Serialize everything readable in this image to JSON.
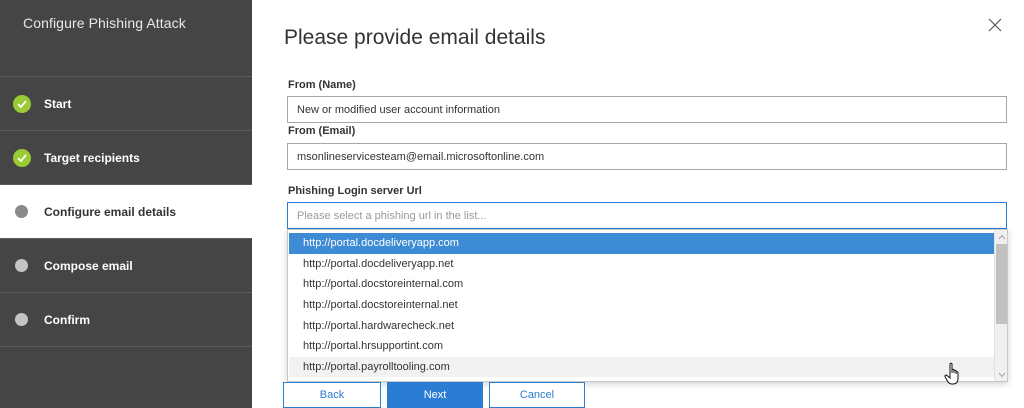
{
  "sidebar": {
    "title": "Configure Phishing Attack",
    "steps": [
      {
        "label": "Start",
        "status": "done"
      },
      {
        "label": "Target recipients",
        "status": "done"
      },
      {
        "label": "Configure email details",
        "status": "current"
      },
      {
        "label": "Compose email",
        "status": "pending"
      },
      {
        "label": "Confirm",
        "status": "pending"
      }
    ]
  },
  "main": {
    "title": "Please provide email details",
    "from_name": {
      "label": "From (Name)",
      "value": "New or modified user account information"
    },
    "from_email": {
      "label": "From (Email)",
      "value": "msonlineservicesteam@email.microsoftonline.com"
    },
    "phishing_url": {
      "label": "Phishing Login server Url",
      "placeholder": "Please select a phishing url in the list..."
    },
    "dropdown_options": [
      "http://portal.docdeliveryapp.com",
      "http://portal.docdeliveryapp.net",
      "http://portal.docstoreinternal.com",
      "http://portal.docstoreinternal.net",
      "http://portal.hardwarecheck.net",
      "http://portal.hrsupportint.com",
      "http://portal.payrolltooling.com"
    ],
    "selected_option_index": 0,
    "hovered_option_index": 6
  },
  "buttons": {
    "back": "Back",
    "next": "Next",
    "cancel": "Cancel"
  },
  "colors": {
    "sidebar_bg": "#454545",
    "check_green": "#9acb34",
    "accent_blue": "#2b7cd3",
    "selected_blue": "#3d8bd4"
  },
  "icons": {
    "close": "close-icon",
    "done": "checkmark-icon",
    "pending": "dot-icon",
    "cursor": "hand-pointer-icon"
  }
}
